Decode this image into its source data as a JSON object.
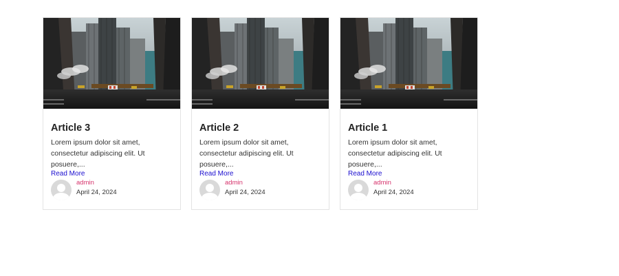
{
  "posts": [
    {
      "title": "Article 3",
      "excerpt": "Lorem ipsum dolor sit amet, consectetur adipiscing elit. Ut posuere,...",
      "read_more": "Read More",
      "author": "admin",
      "date": "April 24, 2024",
      "image": "city-street-photo"
    },
    {
      "title": "Article 2",
      "excerpt": "Lorem ipsum dolor sit amet, consectetur adipiscing elit. Ut posuere,...",
      "read_more": "Read More",
      "author": "admin",
      "date": "April 24, 2024",
      "image": "city-street-photo"
    },
    {
      "title": "Article 1",
      "excerpt": "Lorem ipsum dolor sit amet, consectetur adipiscing elit. Ut posuere,...",
      "read_more": "Read More",
      "author": "admin",
      "date": "April 24, 2024",
      "image": "city-street-photo"
    }
  ],
  "colors": {
    "link": "#1a0dcf",
    "author": "#d6336c",
    "border": "#e3e3e3"
  }
}
